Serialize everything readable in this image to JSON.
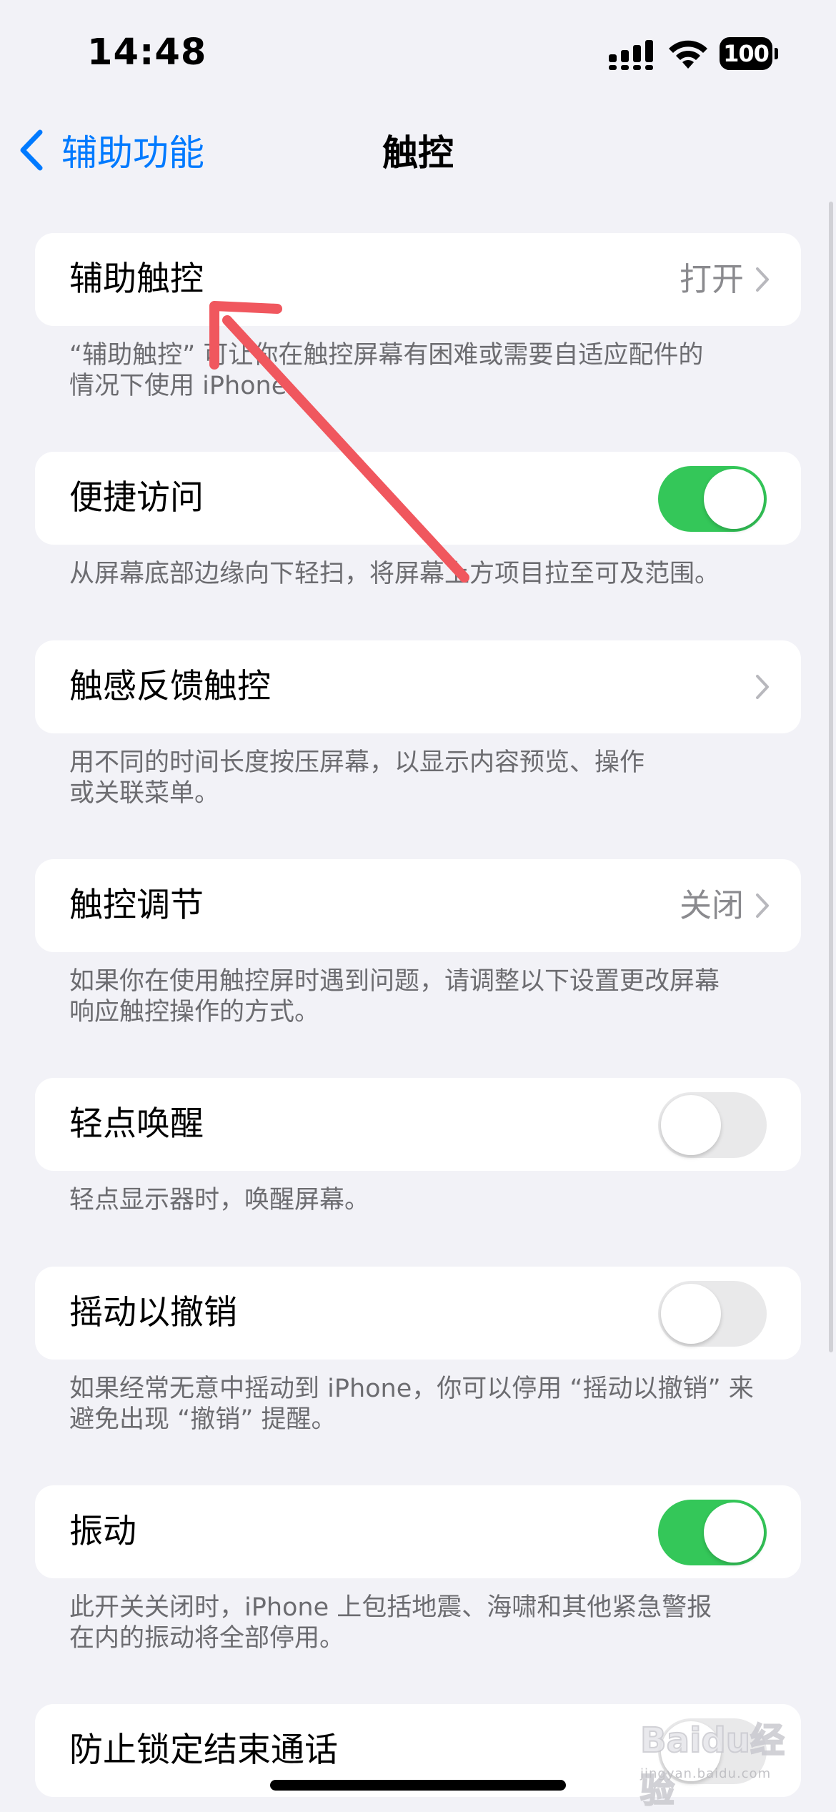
{
  "status_bar": {
    "time": "14:48",
    "battery": "100",
    "icons": [
      "signal-icon",
      "wifi-icon",
      "battery-icon"
    ]
  },
  "nav": {
    "back_label": "辅助功能",
    "title": "触控",
    "accent_color": "#007aff"
  },
  "rows": [
    {
      "label": "辅助触控",
      "value": "打开",
      "type": "link"
    },
    {
      "label": "便捷访问",
      "type": "toggle",
      "on": true
    },
    {
      "label": "触感反馈触控",
      "type": "link"
    },
    {
      "label": "触控调节",
      "value": "关闭",
      "type": "link"
    },
    {
      "label": "轻点唤醒",
      "type": "toggle",
      "on": false
    },
    {
      "label": "摇动以撤销",
      "type": "toggle",
      "on": false
    },
    {
      "label": "振动",
      "type": "toggle",
      "on": true
    },
    {
      "label": "防止锁定结束通话",
      "type": "toggle"
    }
  ],
  "footers": [
    {
      "line1": "“辅助触控” 可让你在触控屏幕有困难或需要自适应配件的",
      "line2": "情况下使用 iPhone。"
    },
    {
      "line1": "从屏幕底部边缘向下轻扫，将屏幕上方项目拉至可及范围。"
    },
    {
      "line1": "用不同的时间长度按压屏幕，以显示内容预览、操作",
      "line2": "或关联菜单。"
    },
    {
      "line1": "如果你在使用触控屏时遇到问题，请调整以下设置更改屏幕",
      "line2": "响应触控操作的方式。"
    },
    {
      "line1": "轻点显示器时，唤醒屏幕。"
    },
    {
      "line1": "如果经常无意中摇动到 iPhone，你可以停用 “摇动以撤销” 来",
      "line2": "避免出现 “撤销” 提醒。"
    },
    {
      "line1": "此开关关闭时，iPhone 上包括地震、海啸和其他紧急警报",
      "line2": "在内的振动将全部停用。"
    }
  ],
  "colors": {
    "toggle_on": "#34c759",
    "toggle_off": "#e9e9ea",
    "annotation_arrow": "#f0575e"
  },
  "watermark": {
    "text": "Baidu经验",
    "sub": "jingyan.baidu.com"
  }
}
